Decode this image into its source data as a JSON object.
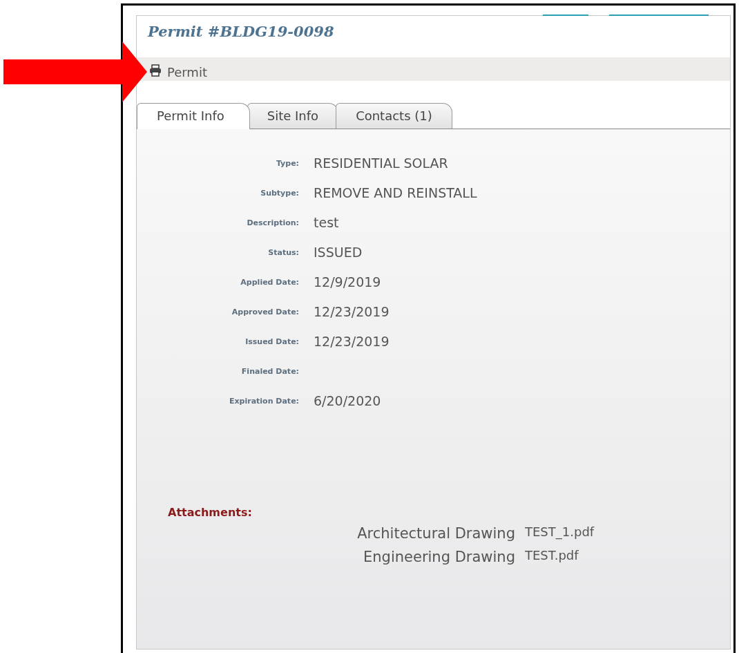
{
  "title": "Permit #BLDG19-0098",
  "print_link": {
    "label": "Permit"
  },
  "tabs": [
    {
      "label": "Permit Info",
      "selected": true
    },
    {
      "label": "Site Info",
      "selected": false
    },
    {
      "label": "Contacts (1)",
      "selected": false
    }
  ],
  "fields": [
    {
      "label": "Type:",
      "value": "RESIDENTIAL SOLAR"
    },
    {
      "label": "Subtype:",
      "value": "REMOVE AND REINSTALL"
    },
    {
      "label": "Description:",
      "value": "test"
    },
    {
      "label": "Status:",
      "value": "ISSUED"
    },
    {
      "label": "Applied Date:",
      "value": "12/9/2019"
    },
    {
      "label": "Approved Date:",
      "value": "12/23/2019"
    },
    {
      "label": "Issued Date:",
      "value": "12/23/2019"
    },
    {
      "label": "Finaled Date:"
    },
    {
      "label": "Expiration Date:",
      "value": "6/20/2020"
    }
  ],
  "attachments": {
    "heading": "Attachments:",
    "items": [
      {
        "name": "Architectural Drawing",
        "file": "TEST_1.pdf"
      },
      {
        "name": "Engineering Drawing",
        "file": "TEST.pdf"
      }
    ]
  }
}
